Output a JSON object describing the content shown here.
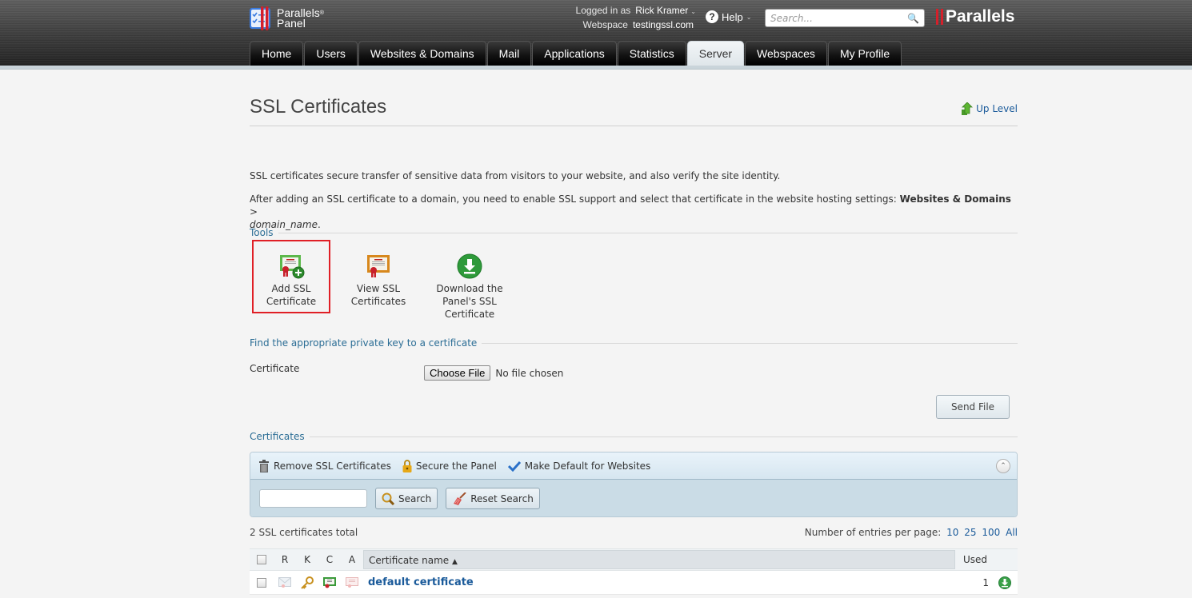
{
  "header": {
    "logo_line1": "Parallels",
    "logo_line2": "Panel",
    "logged_in_label": "Logged in as",
    "user_name": "Rick Kramer",
    "webspace_label": "Webspace",
    "webspace_value": "testingssl.com",
    "help_label": "Help",
    "search_placeholder": "Search...",
    "brand": "Parallels"
  },
  "nav": {
    "tabs": [
      {
        "label": "Home"
      },
      {
        "label": "Users"
      },
      {
        "label": "Websites & Domains"
      },
      {
        "label": "Mail"
      },
      {
        "label": "Applications"
      },
      {
        "label": "Statistics"
      },
      {
        "label": "Server",
        "active": true
      },
      {
        "label": "Webspaces"
      },
      {
        "label": "My Profile"
      }
    ]
  },
  "page": {
    "title": "SSL Certificates",
    "up_level": "Up Level",
    "desc1": "SSL certificates secure transfer of sensitive data from visitors to your website, and also verify the site identity.",
    "desc2_prefix": "After adding an SSL certificate to a domain, you need to enable SSL support and select that certificate in the website hosting settings: ",
    "desc2_bold": "Websites & Domains",
    "desc2_sep": " > ",
    "desc2_italic": "domain_name",
    "desc2_suffix": "."
  },
  "tools": {
    "heading": "Tools",
    "items": [
      {
        "label_line1": "Add SSL",
        "label_line2": "Certificate",
        "icon": "add-certificate-icon",
        "highlighted": true
      },
      {
        "label_line1": "View SSL",
        "label_line2": "Certificates",
        "icon": "view-certificates-icon"
      },
      {
        "label_line1": "Download the",
        "label_line2": "Panel's SSL",
        "label_line3": "Certificate",
        "icon": "download-icon"
      }
    ]
  },
  "private_key": {
    "heading": "Find the appropriate private key to a certificate",
    "field_label": "Certificate",
    "choose_file": "Choose File",
    "no_file": "No file chosen",
    "send_file": "Send File"
  },
  "certificates": {
    "heading": "Certificates",
    "toolbar": {
      "remove": "Remove SSL Certificates",
      "secure": "Secure the Panel",
      "make_default": "Make Default for Websites"
    },
    "search_value": "",
    "search_button": "Search",
    "reset_button": "Reset Search",
    "total": "2 SSL certificates total",
    "per_page_label": "Number of entries per page:",
    "per_page_options": [
      "10",
      "25",
      "100",
      "All"
    ],
    "columns": {
      "r": "R",
      "k": "K",
      "c": "C",
      "a": "A",
      "name": "Certificate name",
      "used": "Used"
    },
    "rows": [
      {
        "name": "default certificate",
        "used": "1"
      }
    ]
  },
  "colors": {
    "accent_link": "#1a5a9a",
    "section_heading": "#2b6d95",
    "highlight_box": "#e01f26",
    "brand_red": "#d4202b"
  }
}
